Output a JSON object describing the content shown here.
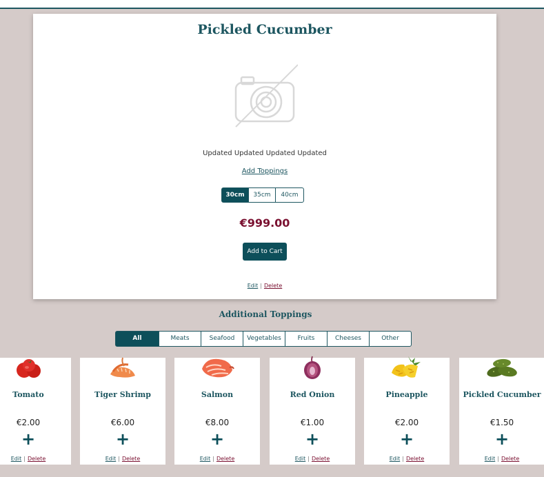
{
  "product": {
    "title": "Pickled Cucumber",
    "description": "Updated Updated Updated Updated",
    "add_toppings_label": "Add Toppings",
    "sizes": [
      {
        "label": "30cm",
        "selected": true
      },
      {
        "label": "35cm",
        "selected": false
      },
      {
        "label": "40cm",
        "selected": false
      }
    ],
    "price": "€999.00",
    "add_to_cart_label": "Add to Cart",
    "edit_label": "Edit",
    "delete_label": "Delete",
    "image_icon": "camera-off-icon"
  },
  "toppings_section": {
    "title": "Additional Toppings",
    "filters": [
      {
        "label": "All",
        "selected": true
      },
      {
        "label": "Meats",
        "selected": false
      },
      {
        "label": "Seafood",
        "selected": false
      },
      {
        "label": "Vegetables",
        "selected": false
      },
      {
        "label": "Fruits",
        "selected": false
      },
      {
        "label": "Cheeses",
        "selected": false
      },
      {
        "label": "Other",
        "selected": false
      }
    ],
    "items": [
      {
        "name": "Tomato",
        "price": "€2.00",
        "image": "tomato-image",
        "edit": "Edit",
        "delete": "Delete"
      },
      {
        "name": "Tiger Shrimp",
        "price": "€6.00",
        "image": "shrimp-image",
        "edit": "Edit",
        "delete": "Delete"
      },
      {
        "name": "Salmon",
        "price": "€8.00",
        "image": "salmon-image",
        "edit": "Edit",
        "delete": "Delete"
      },
      {
        "name": "Red Onion",
        "price": "€1.00",
        "image": "red-onion-image",
        "edit": "Edit",
        "delete": "Delete"
      },
      {
        "name": "Pineapple",
        "price": "€2.00",
        "image": "pineapple-image",
        "edit": "Edit",
        "delete": "Delete"
      },
      {
        "name": "Pickled Cucumber",
        "price": "€1.50",
        "image": "pickles-image",
        "edit": "Edit",
        "delete": "Delete"
      }
    ],
    "add_symbol": "+"
  },
  "colors": {
    "primary": "#0d4f5a",
    "accent_price": "#7a1030",
    "background": "#d5cbc9"
  }
}
